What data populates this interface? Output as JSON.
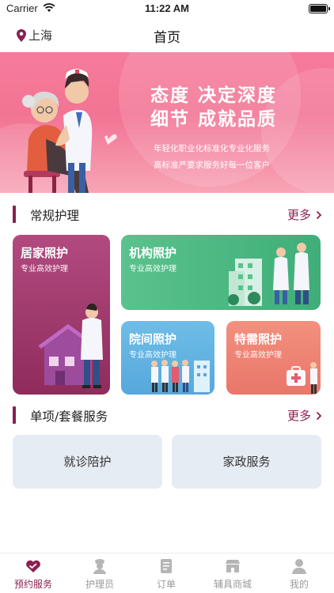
{
  "status_bar": {
    "carrier": "Carrier",
    "time": "11:22 AM"
  },
  "header": {
    "location": "上海",
    "title": "首页"
  },
  "banner": {
    "headline_1": "态度 决定深度",
    "headline_2": "细节 成就品质",
    "sub_1": "年轻化职业化标准化专业化服务",
    "sub_2": "高标准严要求服务好每一位客户"
  },
  "section_care": {
    "title": "常规护理",
    "more": "更多"
  },
  "care_cards": [
    {
      "title": "居家照护",
      "subtitle": "专业高效护理",
      "color": "#a93f75"
    },
    {
      "title": "机构照护",
      "subtitle": "专业高效护理",
      "color": "#52bb86"
    },
    {
      "title": "院间照护",
      "subtitle": "专业高效护理",
      "color": "#5faee0"
    },
    {
      "title": "特需照护",
      "subtitle": "专业高效护理",
      "color": "#ee8575"
    }
  ],
  "section_packages": {
    "title": "单项/套餐服务",
    "more": "更多"
  },
  "package_tiles": [
    {
      "label": "就诊陪护"
    },
    {
      "label": "家政服务"
    }
  ],
  "tabbar": {
    "accent": "#8b1f4f",
    "items": [
      {
        "label": "预约服务",
        "icon": "heart-icon",
        "active": true
      },
      {
        "label": "护理员",
        "icon": "nurse-icon",
        "active": false
      },
      {
        "label": "订单",
        "icon": "order-icon",
        "active": false
      },
      {
        "label": "辅具商城",
        "icon": "shop-icon",
        "active": false
      },
      {
        "label": "我的",
        "icon": "profile-icon",
        "active": false
      }
    ]
  }
}
